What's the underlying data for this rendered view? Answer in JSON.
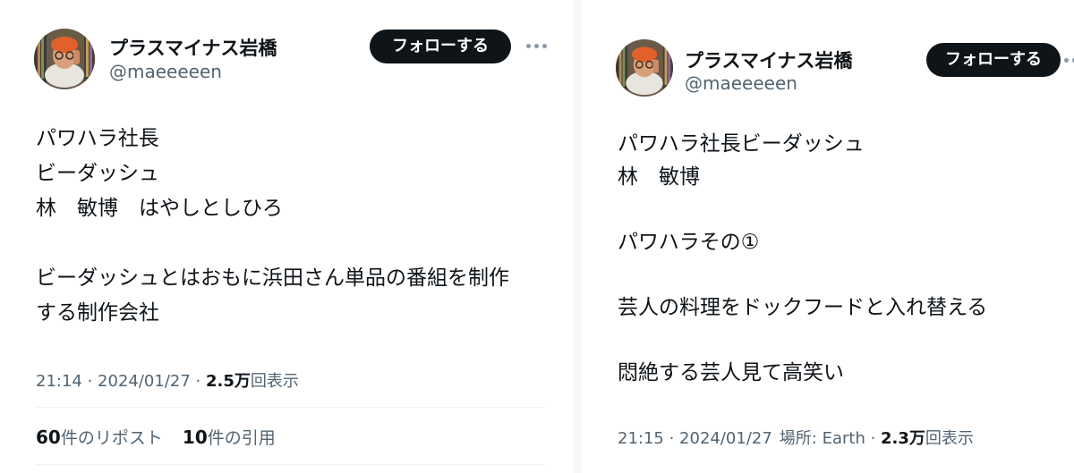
{
  "left_tweet": {
    "display_name": "プラスマイナス岩橋",
    "handle": "@maeeeeen",
    "follow_label": "フォローする",
    "body_lines": [
      "パワハラ社長",
      "ビーダッシュ",
      "林　敏博　はやしとしひろ",
      "",
      "ビーダッシュとはおもに浜田さん単品の番組を制作",
      "する制作会社"
    ],
    "meta": {
      "time": "21:14",
      "date": "2024/01/27",
      "views_count": "2.5万",
      "views_label": "回表示"
    },
    "stats": {
      "reposts_count": "60",
      "reposts_label": "件のリポスト",
      "quotes_count": "10",
      "quotes_label": "件の引用"
    }
  },
  "right_tweet": {
    "display_name": "プラスマイナス岩橋",
    "handle": "@maeeeeen",
    "follow_label": "フォローする",
    "body_lines": [
      "パワハラ社長ビーダッシュ",
      "林　敏博",
      "",
      "パワハラその①",
      "",
      "芸人の料理をドックフードと入れ替える",
      "",
      "悶絶する芸人見て高笑い"
    ],
    "meta": {
      "time": "21:15",
      "date": "2024/01/27",
      "location": "場所: Earth",
      "views_count": "2.3万",
      "views_label": "回表示"
    }
  },
  "separator": " · ",
  "icons": {
    "more": "more-horizontal-icon",
    "avatar": "profile-avatar"
  },
  "colors": {
    "text_primary": "#0f1419",
    "text_secondary": "#536471",
    "follow_button_bg": "#0f1419",
    "follow_button_text": "#ffffff",
    "divider": "#eff3f4"
  }
}
